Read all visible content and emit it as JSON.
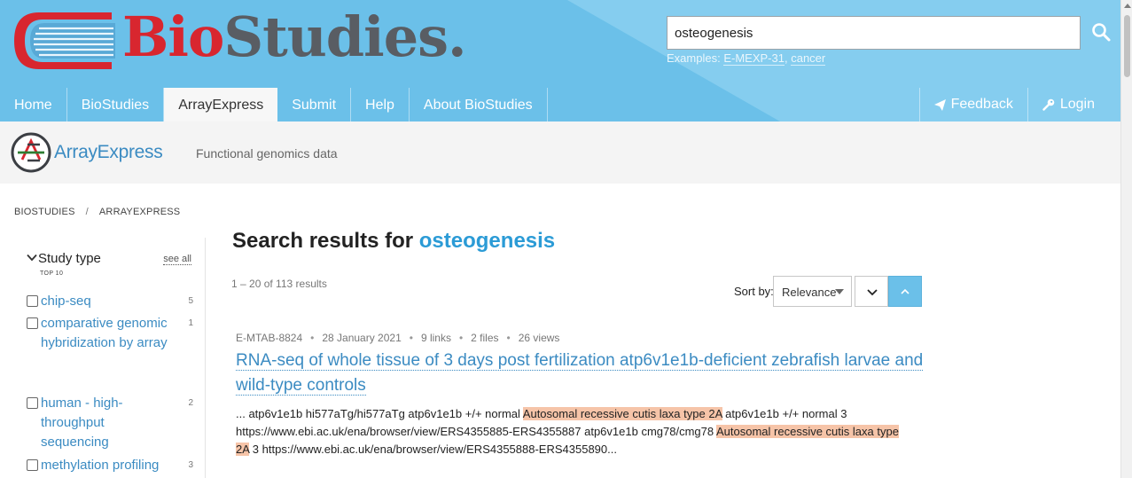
{
  "site": {
    "logo_bio": "Bio",
    "logo_studies": "Studies.",
    "accent": "#6bc0e9",
    "brand_red": "#d8262f"
  },
  "search": {
    "value": "osteogenesis",
    "examples_prefix": "Examples:",
    "example_1": "E-MEXP-31",
    "example_sep": ",",
    "example_2": "cancer",
    "icon": "search-icon"
  },
  "nav": {
    "items": [
      "Home",
      "BioStudies",
      "ArrayExpress",
      "Submit",
      "Help",
      "About BioStudies"
    ],
    "active": "ArrayExpress",
    "feedback": "Feedback",
    "login": "Login"
  },
  "local": {
    "name": "ArrayExpress",
    "tagline": "Functional genomics data"
  },
  "breadcrumb": [
    "BIOSTUDIES",
    "/",
    "ARRAYEXPRESS"
  ],
  "facet": {
    "title": "Study type",
    "subtitle": "TOP 10",
    "see_all": "see all",
    "items": [
      {
        "label": "chip-seq",
        "count": "5"
      },
      {
        "label": "comparative genomic hybridization by array",
        "count": "1"
      },
      {
        "label": "human - high-throughput sequencing",
        "count": "2"
      },
      {
        "label": "methylation profiling",
        "count": "3"
      }
    ]
  },
  "results": {
    "heading": "Search results for",
    "query": "osteogenesis",
    "count_range": "1 – 20",
    "count_text": "of 113 results",
    "sort_label": "Sort by:",
    "sort_value": "Relevance"
  },
  "result": {
    "accession": "E-MTAB-8824",
    "date": "28 January 2021",
    "links": "9 links",
    "files": "2 files",
    "views": "26 views",
    "title": "RNA-seq of whole tissue of 3 days post fertilization atp6v1e1b-deficient zebrafish larvae and wild-type controls",
    "snippet_1": "... atp6v1e1b hi577aTg/hi577aTg atp6v1e1b +/+ normal ",
    "highlight_1": "Autosomal recessive cutis laxa type 2A",
    "snippet_2": " atp6v1e1b +/+ normal 3 https://www.ebi.ac.uk/ena/browser/view/ERS4355885-ERS4355887 atp6v1e1b cmg78/cmg78 ",
    "highlight_2": "Autosomal recessive cutis laxa type 2A",
    "snippet_3": " 3 https://www.ebi.ac.uk/ena/browser/view/ERS4355888-ERS4355890..."
  }
}
